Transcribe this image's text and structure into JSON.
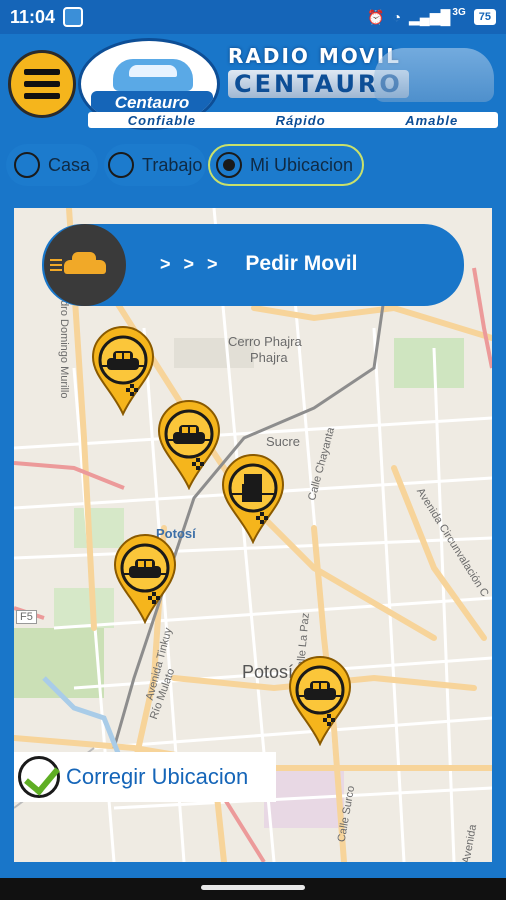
{
  "status_bar": {
    "time": "11:04",
    "network": "3G",
    "battery": "75"
  },
  "header": {
    "logo_text": "Centauro",
    "banner_line1": "RADIO MOVIL",
    "banner_line2": "CENTAURO",
    "tagline": [
      "Confiable",
      "Rápido",
      "Amable"
    ]
  },
  "location_options": [
    {
      "label": "Casa",
      "selected": false
    },
    {
      "label": "Trabajo",
      "selected": false
    },
    {
      "label": "Mi Ubicacion",
      "selected": true
    }
  ],
  "request_bar": {
    "arrows": "> > >",
    "label": "Pedir Movil"
  },
  "map": {
    "labels": {
      "cerro": "Cerro Phajra",
      "phajra": "Phajra",
      "sucre": "Sucre",
      "potosi_small": "Potosí",
      "potosi_big": "Potosí",
      "f5": "F5",
      "avenida_pedro": "Avenida Pedro Domingo Murillo",
      "calle_chayanta": "Calle Chayanta",
      "calle_lapaz": "Calle La Paz",
      "calle_surco": "Calle Surco",
      "av_circunvalacion": "Avenida Circunvalación C",
      "av_tinkuy": "Avenida Tinkuy",
      "rio_mulato": "Río Mulato",
      "avenida": "Avenida"
    },
    "markers": [
      {
        "kind": "taxi"
      },
      {
        "kind": "taxi"
      },
      {
        "kind": "info"
      },
      {
        "kind": "taxi"
      },
      {
        "kind": "taxi"
      }
    ]
  },
  "correct_button": {
    "label": "Corregir Ubicacion"
  },
  "colors": {
    "primary": "#1976c9",
    "accent": "#f5b51c",
    "check": "#5fae24"
  },
  "icons": {
    "menu": "hamburger-icon",
    "check": "checkmark-icon",
    "taxi": "taxi-icon"
  }
}
